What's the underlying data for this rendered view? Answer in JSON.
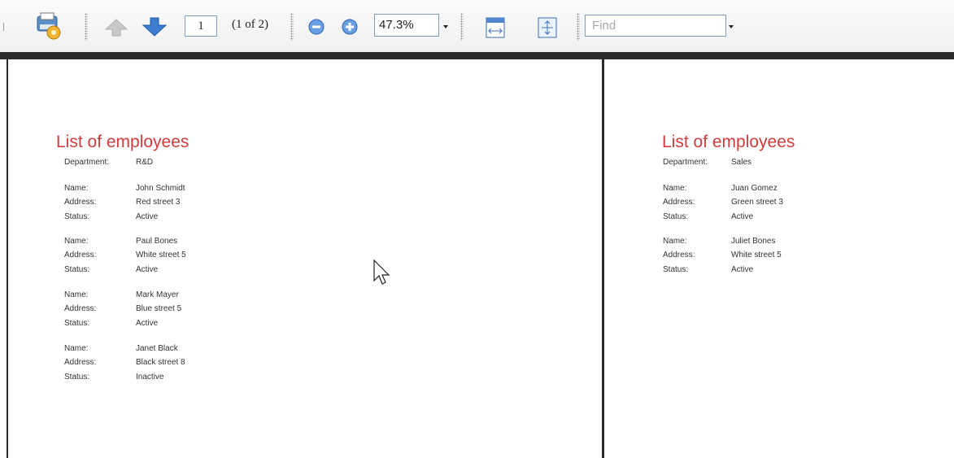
{
  "toolbar": {
    "page_number": "1",
    "page_count": "(1 of 2)",
    "zoom": "47.3%",
    "find_placeholder": "Find"
  },
  "pages": [
    {
      "title": "List of employees",
      "department_label": "Department:",
      "department_value": "R&D",
      "employees": [
        {
          "name_label": "Name:",
          "name": "John Schmidt",
          "address_label": "Address:",
          "address": "Red street 3",
          "status_label": "Status:",
          "status": "Active"
        },
        {
          "name_label": "Name:",
          "name": "Paul Bones",
          "address_label": "Address:",
          "address": "White street 5",
          "status_label": "Status:",
          "status": "Active"
        },
        {
          "name_label": "Name:",
          "name": "Mark Mayer",
          "address_label": "Address:",
          "address": "Blue street 5",
          "status_label": "Status:",
          "status": "Active"
        },
        {
          "name_label": "Name:",
          "name": "Janet Black",
          "address_label": "Address:",
          "address": "Black street 8",
          "status_label": "Status:",
          "status": "Inactive"
        }
      ]
    },
    {
      "title": "List of employees",
      "department_label": "Department:",
      "department_value": "Sales",
      "employees": [
        {
          "name_label": "Name:",
          "name": "Juan Gomez",
          "address_label": "Address:",
          "address": "Green street 3",
          "status_label": "Status:",
          "status": "Active"
        },
        {
          "name_label": "Name:",
          "name": "Juliet Bones",
          "address_label": "Address:",
          "address": "White street 5",
          "status_label": "Status:",
          "status": "Active"
        }
      ]
    }
  ]
}
